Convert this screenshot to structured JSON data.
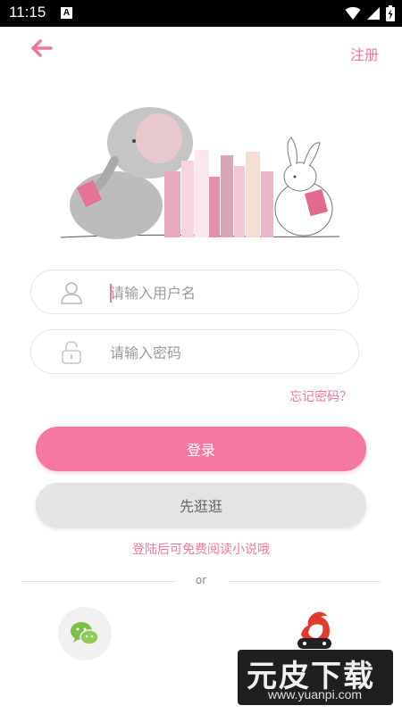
{
  "status_bar": {
    "time": "11:15",
    "notification_letter": "A"
  },
  "header": {
    "back_icon": "arrow-left-icon",
    "register_label": "注册"
  },
  "login_form": {
    "username_placeholder": "请输入用户名",
    "password_placeholder": "请输入密码",
    "forgot_label": "忘记密码？",
    "login_label": "登录",
    "browse_label": "先逛逛",
    "hint": "登陆后可免费阅读小说哦",
    "or_label": "or"
  },
  "social": {
    "left_icon": "wechat-icon",
    "right_icon": "game-rooster-icon"
  },
  "watermark": {
    "main_text": "元皮下载",
    "url": "www.yuanpi.com"
  },
  "colors": {
    "accent": "#f4789f",
    "secondary_button": "#e4e4e4",
    "status_bar": "#000000"
  }
}
